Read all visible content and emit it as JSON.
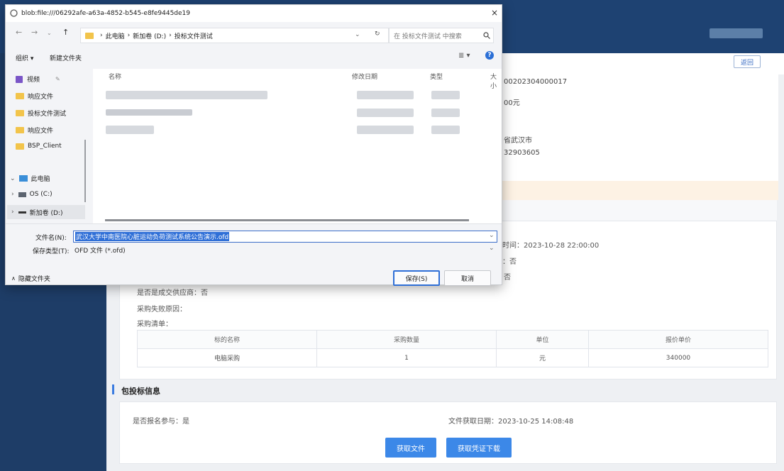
{
  "background": {
    "back_button": "返回",
    "info_lines": [
      "00202304000017",
      "00元",
      "省武汉市",
      "32903605"
    ],
    "time_line": "时间：2023-10-28 22:00:00",
    "line_b": "：否",
    "line_c": "否",
    "is_deal_supplier": "是否是成交供应商：否",
    "fail_reason": "采购失败原因：",
    "purchase_list_label": "采购清单：",
    "table": {
      "headers": [
        "标的名称",
        "采购数量",
        "单位",
        "报价单价"
      ],
      "row": [
        "电脑采购",
        "1",
        "元",
        "340000"
      ]
    },
    "section_title": "包投标信息",
    "registered": "是否报名参与：是",
    "file_date": "文件获取日期：2023-10-25 14:08:48",
    "btn_get_file": "获取文件",
    "btn_get_voucher": "获取凭证下载"
  },
  "dialog": {
    "title": "blob:file:///06292afe-a63a-4852-b545-e8fe9445de19",
    "close": "×",
    "breadcrumb": [
      "此电脑",
      "新加卷 (D:)",
      "投标文件测试"
    ],
    "search_placeholder": "在 投标文件测试 中搜索",
    "organize": "组织 ▾",
    "new_folder": "新建文件夹",
    "sidebar": [
      "视频",
      "响应文件",
      "投标文件测试",
      "响应文件",
      "BSP_Client",
      "此电脑",
      "OS (C:)",
      "新加卷 (D:)"
    ],
    "columns": [
      "名称",
      "修改日期",
      "类型",
      "大小"
    ],
    "filename_label": "文件名(N):",
    "filename_value": "武汉大学中南医院心脏运动负荷测试系统公告演示.ofd",
    "filetype_label": "保存类型(T):",
    "filetype_value": "OFD 文件 (*.ofd)",
    "hide_folders": "隐藏文件夹",
    "save": "保存(S)",
    "cancel": "取消"
  }
}
